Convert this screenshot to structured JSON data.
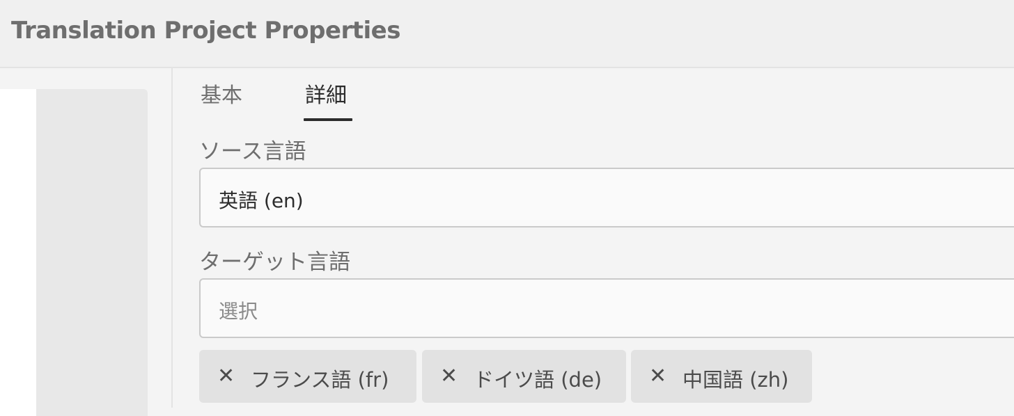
{
  "header": {
    "title": "Translation Project Properties"
  },
  "tabs": {
    "basic": "基本",
    "advanced": "詳細"
  },
  "source_language": {
    "label": "ソース言語",
    "value": "英語 (en)"
  },
  "target_language": {
    "label": "ターゲット言語",
    "placeholder": "選択",
    "tags": [
      {
        "label": "フランス語 (fr)"
      },
      {
        "label": "ドイツ語 (de)"
      },
      {
        "label": "中国語 (zh)"
      }
    ],
    "remove_glyph": "✕"
  },
  "icons": {
    "tag_remove": "close-icon"
  },
  "colors": {
    "title": "#6e6e6e",
    "tab_active_indicator": "#2c2c2c",
    "field_border": "#cacaca",
    "tag_background": "#e2e2e2"
  }
}
